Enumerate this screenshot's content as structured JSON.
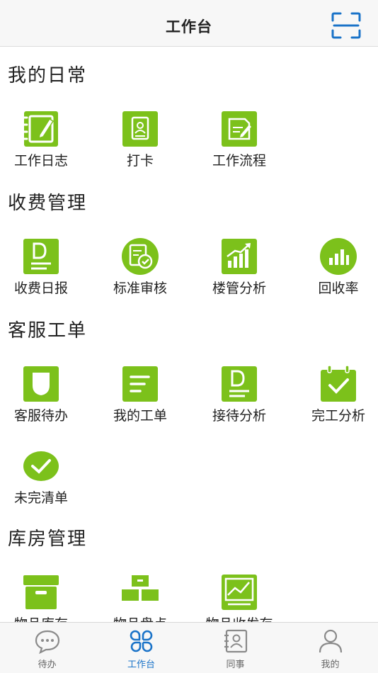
{
  "header": {
    "title": "工作台"
  },
  "sections": [
    {
      "title": "我的日常",
      "items": [
        {
          "label": "工作日志",
          "icon": "journal-icon"
        },
        {
          "label": "打卡",
          "icon": "badge-card-icon"
        },
        {
          "label": "工作流程",
          "icon": "workflow-note-icon"
        }
      ]
    },
    {
      "title": "收费管理",
      "items": [
        {
          "label": "收费日报",
          "icon": "daily-report-icon"
        },
        {
          "label": "标准审核",
          "icon": "review-check-icon"
        },
        {
          "label": "楼管分析",
          "icon": "bar-chart-up-icon"
        },
        {
          "label": "回收率",
          "icon": "bar-chart-circle-icon"
        }
      ]
    },
    {
      "title": "客服工单",
      "items": [
        {
          "label": "客服待办",
          "icon": "shield-icon"
        },
        {
          "label": "我的工单",
          "icon": "list-lines-icon"
        },
        {
          "label": "接待分析",
          "icon": "document-d-icon"
        },
        {
          "label": "完工分析",
          "icon": "calendar-check-icon"
        },
        {
          "label": "未完清单",
          "icon": "check-circle-icon"
        }
      ]
    },
    {
      "title": "库房管理",
      "items": [
        {
          "label": "物品库存",
          "icon": "storage-box-icon"
        },
        {
          "label": "物品盘点",
          "icon": "stacked-boxes-icon"
        },
        {
          "label": "物品收发存",
          "icon": "trend-board-icon"
        }
      ]
    }
  ],
  "tabbar": {
    "tabs": [
      {
        "label": "待办",
        "icon": "chat-bubble-icon"
      },
      {
        "label": "工作台",
        "icon": "grid-clover-icon"
      },
      {
        "label": "同事",
        "icon": "contact-card-icon"
      },
      {
        "label": "我的",
        "icon": "person-icon"
      }
    ],
    "active_index": 1
  },
  "colors": {
    "accent_green": "#7cc11b",
    "active_blue": "#1a73c8",
    "header_bg": "#f7f7f7"
  }
}
